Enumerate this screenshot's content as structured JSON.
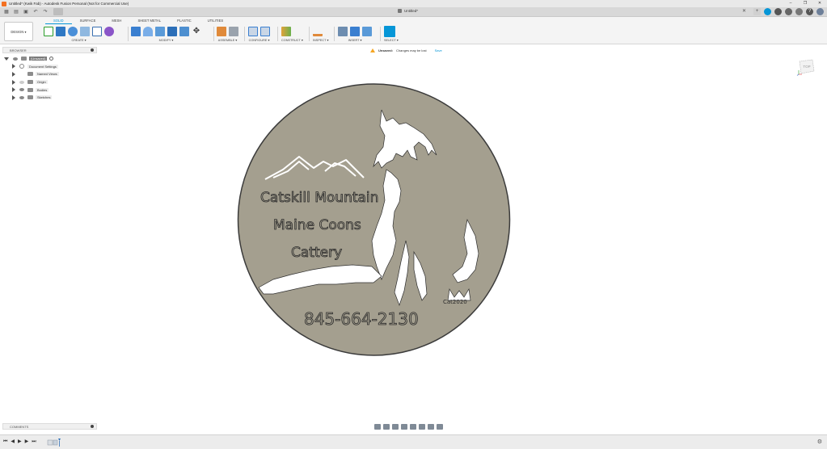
{
  "window": {
    "title": "Untitled* (Kwik Fab) - Autodesk Fusion Personal (Not for Commercial Use)",
    "controls": [
      "–",
      "❐",
      "✕"
    ]
  },
  "appbar": {
    "doc_tab": "Untitled*",
    "close": "✕"
  },
  "ribbon": {
    "workspace": "DESIGN ▾",
    "tabs": [
      {
        "label": "SOLID",
        "active": true
      },
      {
        "label": "SURFACE",
        "active": false
      },
      {
        "label": "MESH",
        "active": false
      },
      {
        "label": "SHEET METAL",
        "active": false
      },
      {
        "label": "PLASTIC",
        "active": false
      },
      {
        "label": "UTILITIES",
        "active": false
      }
    ],
    "groups": {
      "create": "CREATE ▾",
      "modify": "MODIFY ▾",
      "assemble": "ASSEMBLE ▾",
      "configure": "CONFIGURE ▾",
      "construct": "CONSTRUCT ▾",
      "inspect": "INSPECT ▾",
      "insert": "INSERT ▾",
      "select": "SELECT ▾"
    }
  },
  "browser": {
    "header": "BROWSER",
    "root": "(Unsaved)",
    "items": [
      {
        "label": "Document Settings",
        "icon": "gear-icon"
      },
      {
        "label": "Named Views",
        "icon": "folder-icon"
      },
      {
        "label": "Origin",
        "icon": "folder-icon"
      },
      {
        "label": "Bodies",
        "icon": "folder-icon"
      },
      {
        "label": "Sketches",
        "icon": "folder-icon"
      }
    ]
  },
  "notice": {
    "status": "Unsaved:",
    "message": "Changes may be lost",
    "save": "Save"
  },
  "viewcube": {
    "face": "TOP"
  },
  "model": {
    "line1": "Catskill Mountain",
    "line2": "Maine Coons",
    "line3": "Cattery",
    "phone": "845-664-2130",
    "signature": "Cat2020",
    "disc_color": "#a49f8f",
    "outline_color": "#3b3b3b"
  },
  "comments": {
    "header": "COMMENTS"
  },
  "timeline": {
    "controls": [
      "⏮",
      "◀",
      "▶",
      "▶",
      "⏭"
    ],
    "settings": "⚙"
  },
  "colors": {
    "accent": "#0696d7",
    "warning": "#f5a623"
  }
}
